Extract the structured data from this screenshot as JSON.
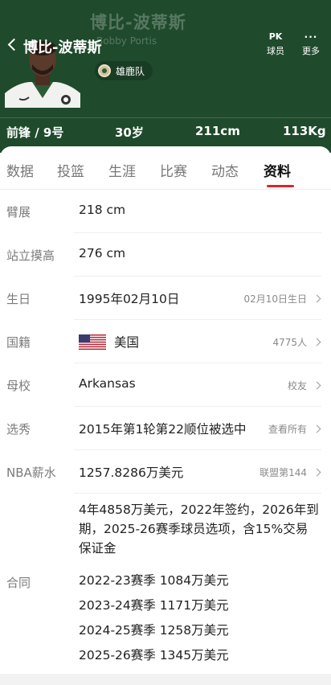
{
  "header": {
    "bg_name": "博比-波蒂斯",
    "bg_english": "Bobby Portis",
    "title": "博比-波蒂斯",
    "pk_icon": "PK",
    "pk_label": "球员",
    "more_icon": "···",
    "more_label": "更多",
    "team": "雄鹿队",
    "stats": [
      "前锋 / 9号",
      "30岁",
      "211cm",
      "113Kg"
    ],
    "bg_color": "#1f4a2c"
  },
  "tabs": [
    {
      "label": "数据",
      "active": false
    },
    {
      "label": "投篮",
      "active": false
    },
    {
      "label": "生涯",
      "active": false
    },
    {
      "label": "比赛",
      "active": false
    },
    {
      "label": "动态",
      "active": false
    },
    {
      "label": "资料",
      "active": true
    }
  ],
  "accent_color": "#d6262e",
  "profile": {
    "wingspan": {
      "label": "臂展",
      "value": "218 cm"
    },
    "reach": {
      "label": "站立摸高",
      "value": "276 cm"
    },
    "birthday": {
      "label": "生日",
      "value": "1995年02月10日",
      "extra": "02月10日生日"
    },
    "nationality": {
      "label": "国籍",
      "value": "美国",
      "extra": "4775人",
      "flag_icon": "usa-flag-icon"
    },
    "college": {
      "label": "母校",
      "value": "Arkansas",
      "extra": "校友"
    },
    "draft": {
      "label": "选秀",
      "value": "2015年第1轮第22顺位被选中",
      "extra": "查看所有"
    },
    "salary": {
      "label": "NBA薪水",
      "value": "1257.8286万美元",
      "extra": "联盟第144"
    },
    "contract": {
      "label": "合同",
      "summary": "4年4858万美元，2022年签约，2026年到期，2025-26赛季球员选项，含15%交易保证金",
      "seasons": [
        "2022-23赛季 1084万美元",
        "2023-24赛季 1171万美元",
        "2024-25赛季 1258万美元",
        "2025-26赛季 1345万美元"
      ]
    }
  }
}
